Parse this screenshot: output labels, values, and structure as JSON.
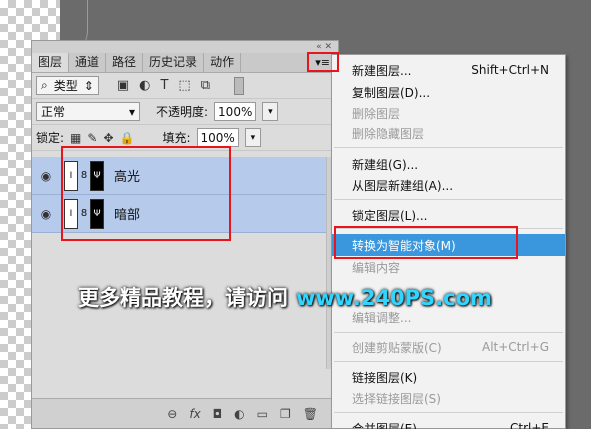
{
  "panel": {
    "tabs": [
      "图层",
      "通道",
      "路径",
      "历史记录",
      "动作"
    ],
    "filter_kind": "类型",
    "blend_mode": "正常",
    "opacity_label": "不透明度:",
    "opacity_value": "100%",
    "lock_label": "锁定:",
    "fill_label": "填充:",
    "fill_value": "100%",
    "layers": [
      {
        "name": "高光"
      },
      {
        "name": "暗部"
      }
    ]
  },
  "menu": {
    "items": [
      {
        "label": "新建图层...",
        "shortcut": "Shift+Ctrl+N"
      },
      {
        "label": "复制图层(D)..."
      },
      {
        "label": "删除图层"
      },
      {
        "label": "删除隐藏图层"
      },
      {
        "label": "新建组(G)..."
      },
      {
        "label": "从图层新建组(A)..."
      },
      {
        "label": "锁定图层(L)..."
      },
      {
        "label": "转换为智能对象(M)"
      },
      {
        "label": "编辑内容"
      },
      {
        "label": "编辑调整..."
      },
      {
        "label": "创建剪贴蒙版(C)",
        "shortcut": "Alt+Ctrl+G"
      },
      {
        "label": "链接图层(K)"
      },
      {
        "label": "选择链接图层(S)"
      },
      {
        "label": "合并图层(E)",
        "shortcut": "Ctrl+E"
      }
    ]
  },
  "watermark": {
    "text": "更多精品教程，请访问",
    "url": "www.240PS.com"
  }
}
